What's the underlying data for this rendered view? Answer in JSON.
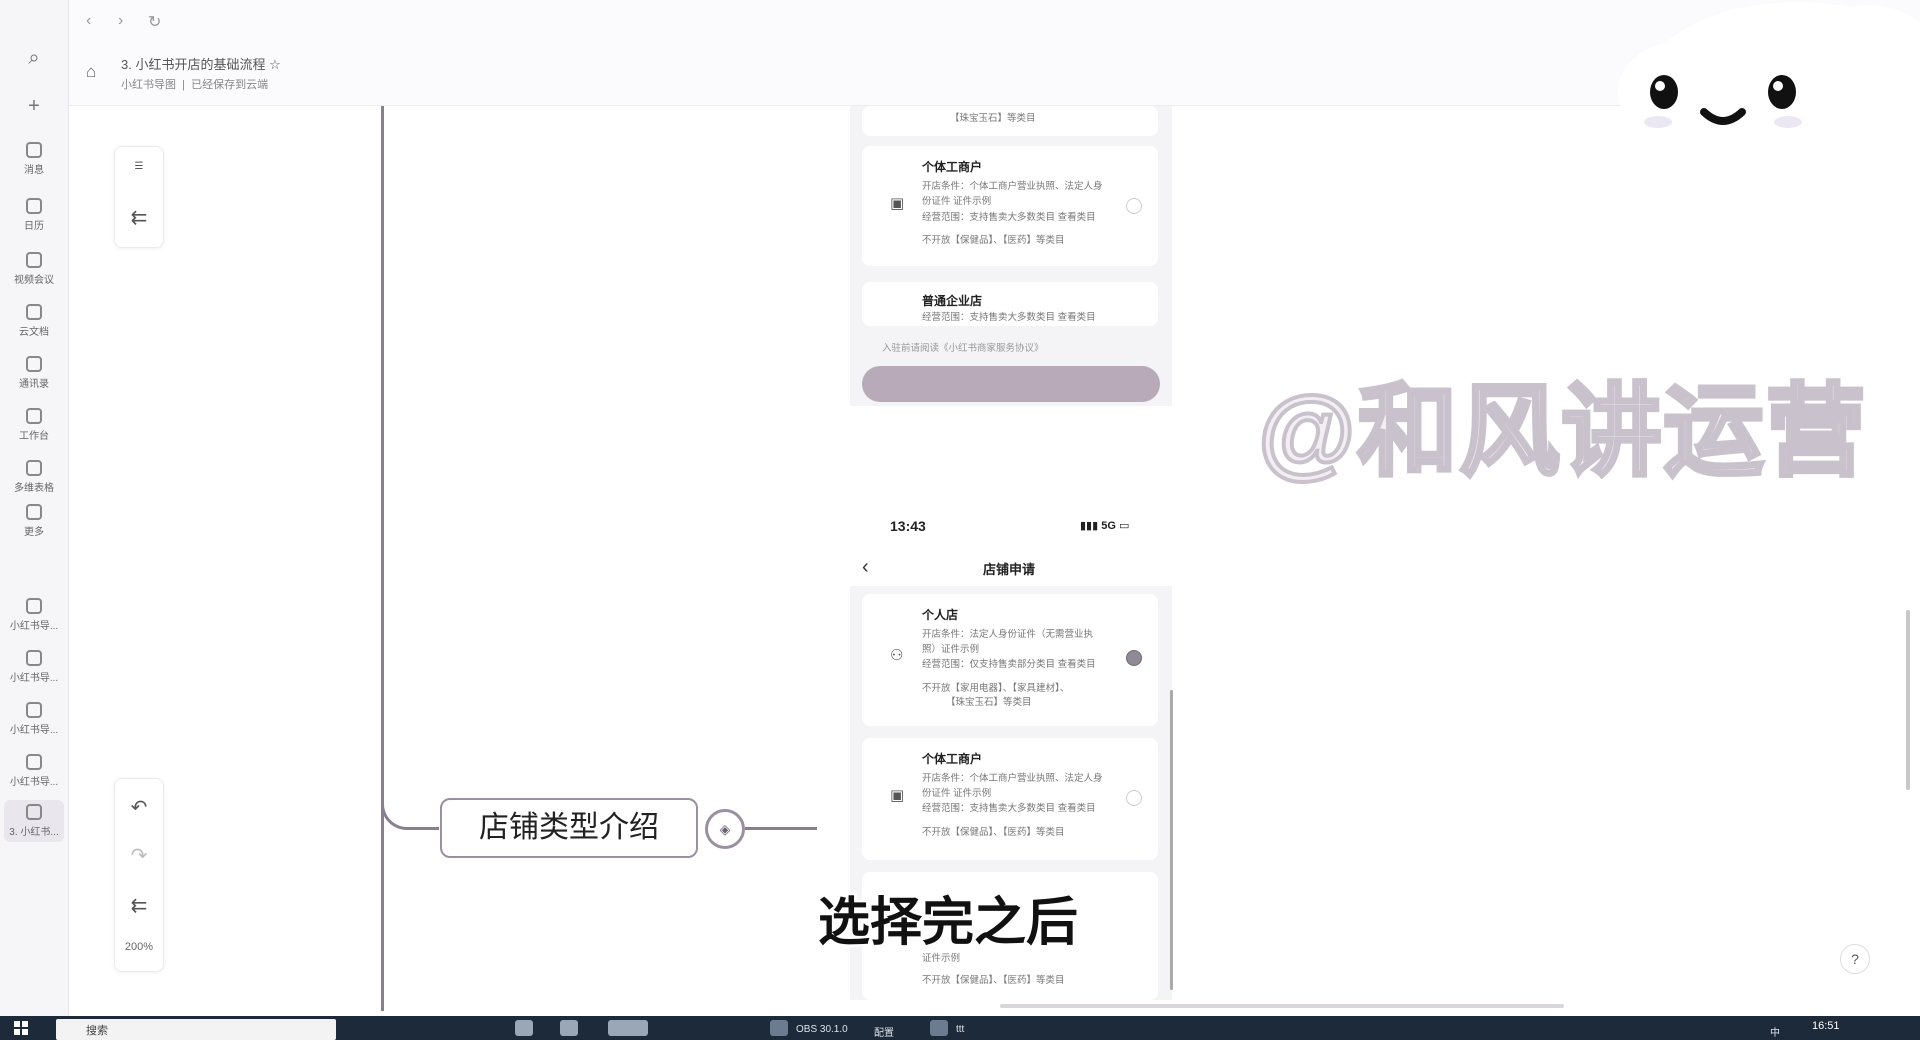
{
  "topbar": {
    "doc_title": "3. 小红书开店的基础流程",
    "breadcrumb": "小红书导图",
    "save_status": "已经保存到云端"
  },
  "sidebar": {
    "items": [
      {
        "label": "消息",
        "icon": "chat-icon"
      },
      {
        "label": "日历",
        "icon": "calendar-icon"
      },
      {
        "label": "视频会议",
        "icon": "video-icon"
      },
      {
        "label": "云文档",
        "icon": "doc-icon"
      },
      {
        "label": "通讯录",
        "icon": "contacts-icon"
      },
      {
        "label": "工作台",
        "icon": "grid-icon"
      },
      {
        "label": "多维表格",
        "icon": "table-icon"
      },
      {
        "label": "更多",
        "icon": "more-icon"
      },
      {
        "label": "小红书导...",
        "icon": "doc-icon"
      },
      {
        "label": "小红书导...",
        "icon": "doc-icon"
      },
      {
        "label": "小红书导...",
        "icon": "doc-icon"
      },
      {
        "label": "小红书导...",
        "icon": "doc-icon"
      },
      {
        "label": "3. 小红书...",
        "icon": "doc-icon"
      }
    ]
  },
  "toolbar": {
    "zoom": "200%"
  },
  "mindmap": {
    "node_label": "店铺类型介绍"
  },
  "phone_top": {
    "tag_line_top": "【珠宝玉石】等类目",
    "card_individual": {
      "title": "个体工商户",
      "line1": "开店条件：个体工商户营业执照、法定人身",
      "line2": "份证件 证件示例",
      "line3": "经营范围：支持售卖大多数类目 查看类目",
      "line4": "不开放【保健品】、【医药】等类目"
    },
    "card_company": {
      "title": "普通企业店",
      "line1": "经营范围：支持售卖大多数类目 查看类目"
    },
    "agreement": "入驻前请阅读《小红书商家服务协议》"
  },
  "phone_bottom": {
    "time": "13:43",
    "network": "5G",
    "page_title": "店铺申请",
    "card_personal": {
      "title": "个人店",
      "line1": "开店条件：法定人身份证件（无需营业执",
      "line2": "照）证件示例",
      "line3": "经营范围：仅支持售卖部分类目 查看类目",
      "line4": "不开放【家用电器】、【家具建材】、",
      "line5": "【珠宝玉石】等类目"
    },
    "card_individual": {
      "title": "个体工商户",
      "line1": "开店条件：个体工商户营业执照、法定人身",
      "line2": "份证件 证件示例",
      "line3": "经营范围：支持售卖大多数类目 查看类目",
      "line4": "不开放【保健品】、【医药】等类目"
    },
    "card_partial": {
      "line1": "证件示例",
      "line2": "不开放【保健品】、【医药】等类目"
    }
  },
  "overlay": {
    "watermark": "@和风讲运营",
    "caption": "选择完之后"
  },
  "taskbar": {
    "search_placeholder": "搜索",
    "obs_label": "OBS 30.1.0",
    "app2_label": "配置",
    "app3_label": "ttt",
    "clock": "16:51",
    "ime": "中"
  }
}
